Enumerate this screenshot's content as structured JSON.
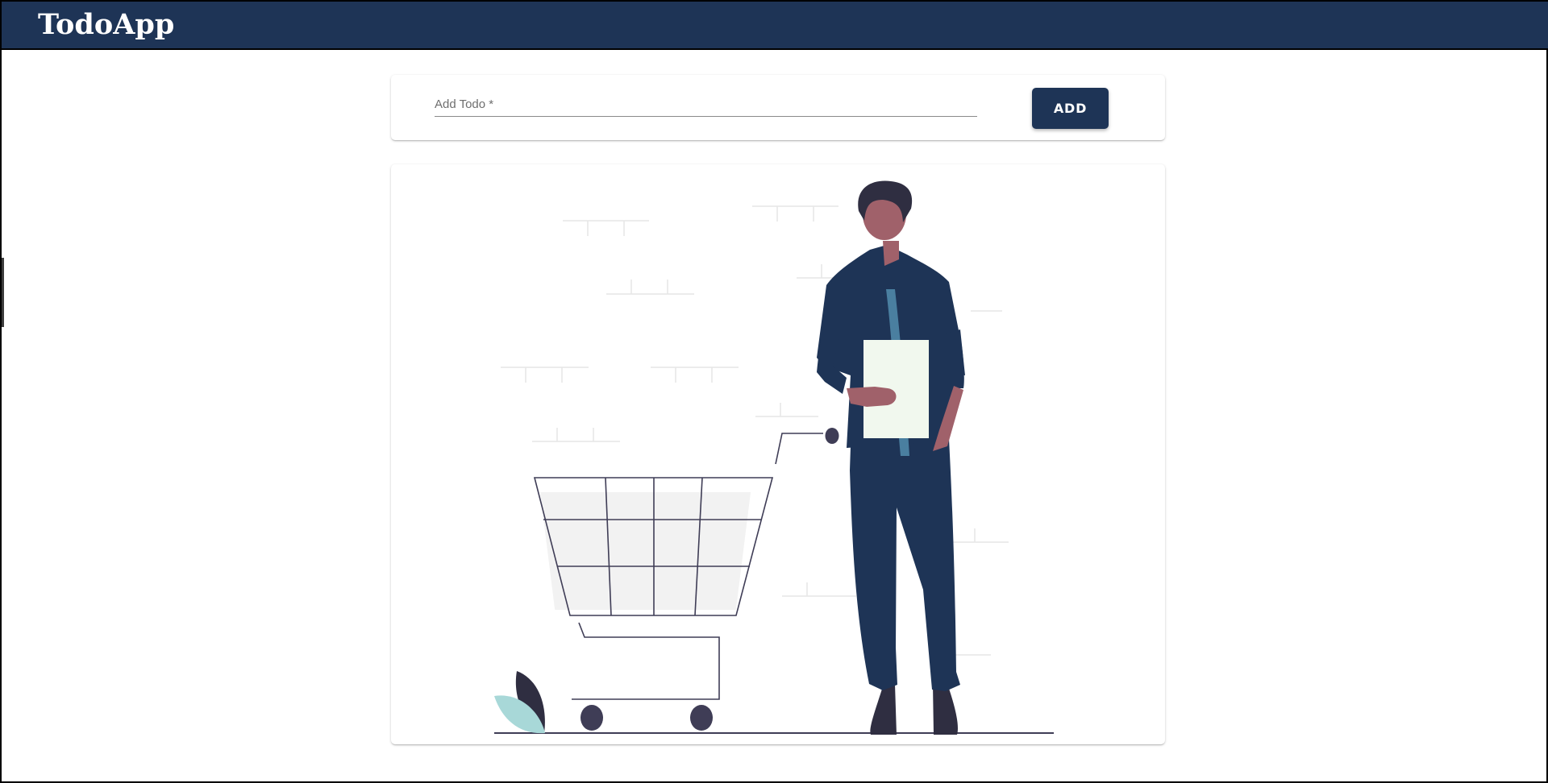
{
  "app": {
    "title": "TodoApp"
  },
  "add_todo": {
    "input_label": "Add Todo *",
    "input_value": "",
    "button_label": "ADD"
  },
  "colors": {
    "primary": "#1e3456",
    "skin": "#a0616a",
    "paper": "#f1f8ee",
    "leaf_light": "#a8d8d8",
    "leaf_dark": "#2f2e41",
    "cart_fill": "#f2f2f2"
  },
  "illustration": {
    "name": "shopping-cart-illustration"
  }
}
